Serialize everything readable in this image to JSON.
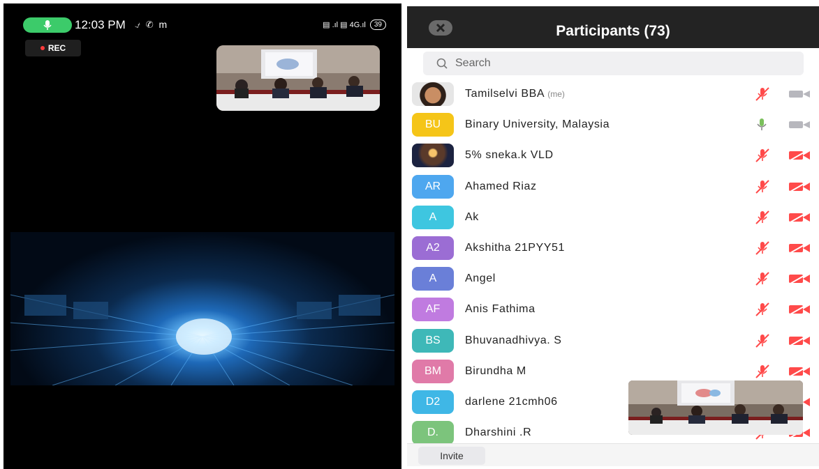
{
  "status_bar": {
    "time": "12:03 PM",
    "left_icons": "⍻ ✆ m",
    "right_icons": "▤ .ıl ▤ 4G.ıl",
    "battery": "39"
  },
  "rec_label": "REC",
  "participants_panel": {
    "title": "Participants (73)",
    "search_placeholder": "Search",
    "invite_label": "Invite",
    "participants": [
      {
        "initials": "",
        "avatar_color": "#c9a07a",
        "name": "Tamilselvi BBA",
        "me_tag": "(me)",
        "mic": "muted",
        "camera": "on-gray"
      },
      {
        "initials": "BU",
        "avatar_color": "#f5c518",
        "name": "Binary University, Malaysia",
        "me_tag": "",
        "mic": "on",
        "camera": "on-gray"
      },
      {
        "initials": "",
        "avatar_color": "#3b2f2b",
        "name": "5% sneka.k VLD",
        "me_tag": "",
        "mic": "muted",
        "camera": "off"
      },
      {
        "initials": "AR",
        "avatar_color": "#4ea7ef",
        "name": "Ahamed Riaz",
        "me_tag": "",
        "mic": "muted",
        "camera": "off"
      },
      {
        "initials": "A",
        "avatar_color": "#3ec6e0",
        "name": "Ak",
        "me_tag": "",
        "mic": "muted",
        "camera": "off"
      },
      {
        "initials": "A2",
        "avatar_color": "#9b6dd4",
        "name": "Akshitha 21PYY51",
        "me_tag": "",
        "mic": "muted",
        "camera": "off"
      },
      {
        "initials": "A",
        "avatar_color": "#6a7fd8",
        "name": "Angel",
        "me_tag": "",
        "mic": "muted",
        "camera": "off"
      },
      {
        "initials": "AF",
        "avatar_color": "#c07be0",
        "name": "Anis Fathima",
        "me_tag": "",
        "mic": "muted",
        "camera": "off"
      },
      {
        "initials": "BS",
        "avatar_color": "#3eb8b8",
        "name": "Bhuvanadhivya. S",
        "me_tag": "",
        "mic": "muted",
        "camera": "off"
      },
      {
        "initials": "BM",
        "avatar_color": "#e07aa8",
        "name": "Birundha M",
        "me_tag": "",
        "mic": "muted",
        "camera": "off"
      },
      {
        "initials": "D2",
        "avatar_color": "#3fb7e6",
        "name": "darlene 21cmh06",
        "me_tag": "",
        "mic": "muted",
        "camera": "off"
      },
      {
        "initials": "D.",
        "avatar_color": "#7cc47c",
        "name": "Dharshini .R",
        "me_tag": "",
        "mic": "muted",
        "camera": "off"
      }
    ]
  },
  "colors": {
    "mic_pill": "#3ccb6a",
    "muted_red": "#ff4a4a",
    "header_bg": "#232323"
  }
}
